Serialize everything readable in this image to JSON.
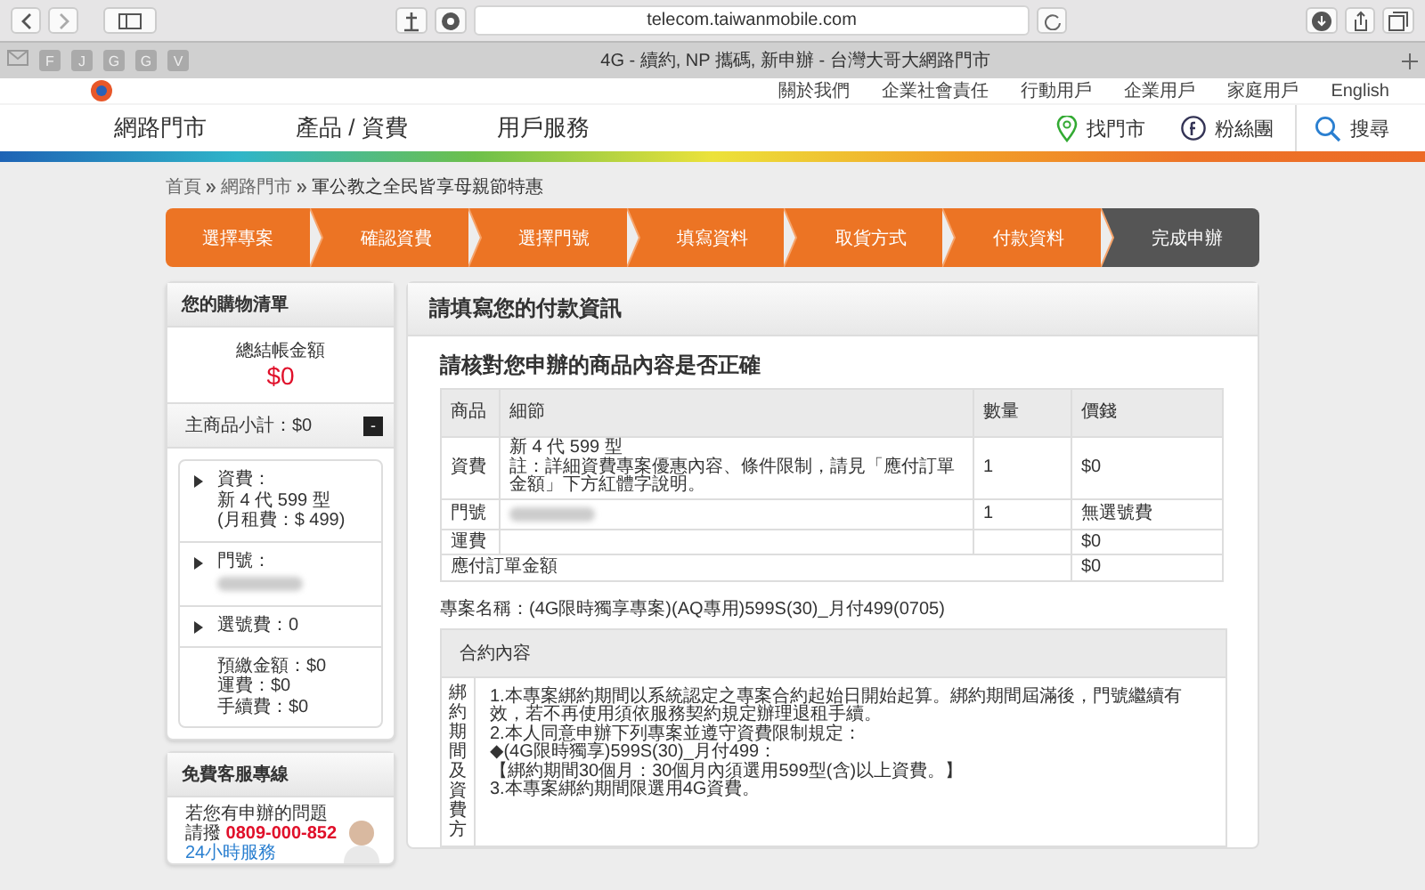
{
  "browser": {
    "url": "telecom.taiwanmobile.com",
    "tab_title": "4G - 續約, NP 攜碼, 新申辦 - 台灣大哥大網路門市",
    "bookmarks": [
      "F",
      "J",
      "G",
      "G",
      "V"
    ]
  },
  "site": {
    "top_links": [
      "關於我們",
      "企業社會責任",
      "行動用戶",
      "企業用戶",
      "家庭用戶",
      "English"
    ],
    "nav": [
      "網路門市",
      "產品 / 資費",
      "用戶服務"
    ],
    "nav_right": [
      {
        "kind": "store",
        "label": "找門市"
      },
      {
        "kind": "facebook",
        "label": "粉絲團"
      },
      {
        "kind": "search",
        "label": "搜尋"
      }
    ]
  },
  "breadcrumb": [
    "首頁",
    "網路門市",
    "軍公教之全民皆享母親節特惠"
  ],
  "steps": [
    {
      "label": "選擇專案",
      "selected": false
    },
    {
      "label": "確認資費",
      "selected": false
    },
    {
      "label": "選擇門號",
      "selected": false
    },
    {
      "label": "填寫資料",
      "selected": false
    },
    {
      "label": "取貨方式",
      "selected": false
    },
    {
      "label": "付款資料",
      "selected": false
    },
    {
      "label": "完成申辦",
      "selected": true
    }
  ],
  "sidebar": {
    "title": "您的購物清單",
    "total_label": "總結帳金額",
    "total": "$0",
    "subtotal": "主商品小計：$0",
    "collapse": "-",
    "items": [
      {
        "kind": "expandable",
        "lines": [
          "資費：",
          "新 4 代 599 型",
          "(月租費：$ 499)"
        ],
        "redacted": false
      },
      {
        "kind": "expandable",
        "lines": [
          "門號："
        ],
        "redacted": true
      },
      {
        "kind": "expandable",
        "lines": [
          "選號費：0"
        ],
        "redacted": false
      },
      {
        "kind": "plain",
        "lines": [
          "預繳金額：$0",
          "運費：$0",
          "手續費：$0"
        ],
        "redacted": false
      }
    ],
    "hotline": {
      "title": "免費客服專線",
      "question": "若您有申辦的問題",
      "call": "請撥",
      "phone": "0809-000-852",
      "service": "24小時服務"
    }
  },
  "main": {
    "title": "請填寫您的付款資訊",
    "heading": "請核對您申辦的商品內容是否正確",
    "columns": [
      "商品",
      "細節",
      "數量",
      "價錢"
    ],
    "rows": [
      {
        "kind": "item",
        "item": "資費",
        "detail": [
          "新 4 代 599 型",
          "註：詳細資費專案優惠內容、條件限制，請見「應付訂單金額」下方紅體字說明。"
        ],
        "redacted": false,
        "qty": "1",
        "price": "$0"
      },
      {
        "kind": "item",
        "item": "門號",
        "detail": [],
        "redacted": true,
        "qty": "1",
        "price": "無選號費"
      },
      {
        "kind": "item",
        "item": "運費",
        "detail": [],
        "redacted": false,
        "qty": "",
        "price": "$0"
      },
      {
        "kind": "total",
        "item": "應付訂單金額",
        "price": "$0"
      }
    ],
    "plan_name": "專案名稱：(4G限時獨享專案)(AQ專用)599S(30)_月付499(0705)",
    "contract": {
      "header": "合約內容",
      "side_label": "綁約期間及資費方",
      "lines": [
        "1.本專案綁約期間以系統認定之專案合約起始日開始起算。綁約期間屆滿後，門號繼續有效，若不再使用須依服務契約規定辦理退租手續。",
        "2.本人同意申辦下列專案並遵守資費限制規定：",
        "◆(4G限時獨享)599S(30)_月付499：",
        "【綁約期間30個月：30個月內須選用599型(含)以上資費。】",
        "3.本專案綁約期間限選用4G資費。"
      ]
    }
  }
}
